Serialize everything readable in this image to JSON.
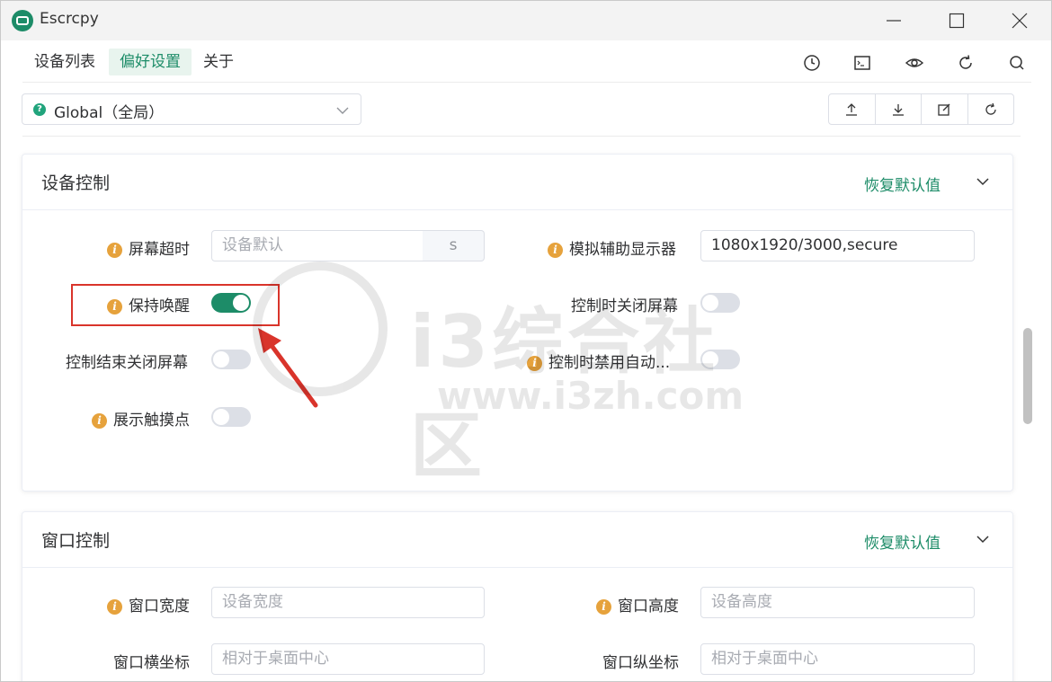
{
  "window": {
    "title": "Escrcpy"
  },
  "menu": {
    "items": [
      "设备列表",
      "偏好设置",
      "关于"
    ],
    "active_index": 1
  },
  "toolbar_icons": [
    "clock-icon",
    "terminal-icon",
    "eye-icon",
    "refresh-icon",
    "search-icon"
  ],
  "preset": {
    "value": "Global（全局）",
    "actions": [
      "upload-icon",
      "download-icon",
      "edit-icon",
      "reset-icon"
    ]
  },
  "sections": {
    "device_control": {
      "title": "设备控制",
      "reset_label": "恢复默认值",
      "fields": {
        "screen_timeout": {
          "label": "屏幕超时",
          "placeholder": "设备默认",
          "unit": "s"
        },
        "virtual_display": {
          "label": "模拟辅助显示器",
          "value": "1080x1920/3000,secure"
        },
        "stay_awake": {
          "label": "保持唤醒",
          "on": true
        },
        "turn_screen_off": {
          "label": "控制时关闭屏幕",
          "on": false
        },
        "power_off_on_close": {
          "label": "控制结束关闭屏幕",
          "on": false
        },
        "disable_screensaver": {
          "label": "控制时禁用自动...",
          "on": false
        },
        "show_touches": {
          "label": "展示触摸点",
          "on": false
        }
      }
    },
    "window_control": {
      "title": "窗口控制",
      "reset_label": "恢复默认值",
      "fields": {
        "window_width": {
          "label": "窗口宽度",
          "placeholder": "设备宽度"
        },
        "window_height": {
          "label": "窗口高度",
          "placeholder": "设备高度"
        },
        "window_x": {
          "label": "窗口横坐标",
          "placeholder": "相对于桌面中心"
        },
        "window_y": {
          "label": "窗口纵坐标",
          "placeholder": "相对于桌面中心"
        }
      }
    }
  },
  "watermark": {
    "text": "i3综合社区",
    "url": "www.i3zh.com"
  },
  "colors": {
    "accent": "#1d8c68",
    "highlight": "#d9342b",
    "info": "#e6a23c"
  }
}
